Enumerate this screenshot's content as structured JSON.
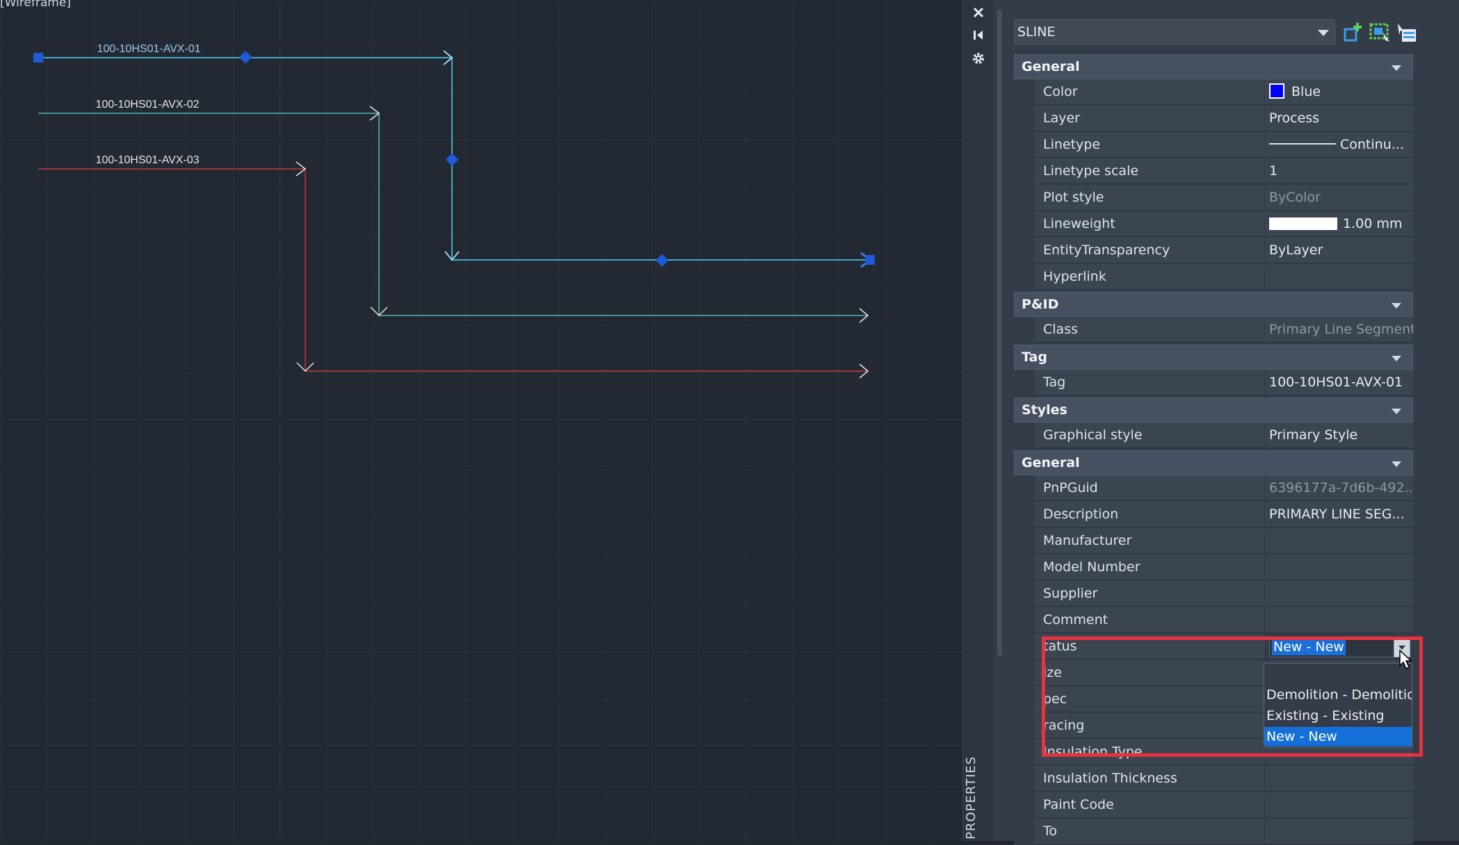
{
  "canvas": {
    "view_label": "[Wireframe]",
    "lines": [
      {
        "tag": "100-10HS01-AVX-01",
        "color": "#4fc6c0",
        "selected": true
      },
      {
        "tag": "100-10HS01-AVX-02",
        "color": "#55b7bd",
        "selected": false
      },
      {
        "tag": "100-10HS01-AVX-03",
        "color": "#c8373b",
        "selected": false
      }
    ]
  },
  "strip": {
    "title": "PROPERTIES",
    "icons": [
      "close-icon",
      "auto-hide-icon",
      "settings-icon"
    ]
  },
  "selector": {
    "value": "SLINE",
    "buttons": [
      "toggle-pickadd-icon",
      "select-objects-icon",
      "quick-select-icon"
    ]
  },
  "sections": [
    {
      "title": "General",
      "rows": [
        {
          "name": "Color",
          "value": "Blue",
          "kind": "color",
          "swatch": "#0000ff"
        },
        {
          "name": "Layer",
          "value": "Process"
        },
        {
          "name": "Linetype",
          "value": "Continu...",
          "kind": "linetype"
        },
        {
          "name": "Linetype scale",
          "value": "1"
        },
        {
          "name": "Plot style",
          "value": "ByColor",
          "dim": true
        },
        {
          "name": "Lineweight",
          "value": "1.00 mm",
          "kind": "lineweight"
        },
        {
          "name": "EntityTransparency",
          "value": "ByLayer"
        },
        {
          "name": "Hyperlink",
          "value": ""
        }
      ]
    },
    {
      "title": "P&ID",
      "rows": [
        {
          "name": "Class",
          "value": "Primary Line Segment",
          "dim": true
        }
      ]
    },
    {
      "title": "Tag",
      "rows": [
        {
          "name": "Tag",
          "value": "100-10HS01-AVX-01"
        }
      ]
    },
    {
      "title": "Styles",
      "rows": [
        {
          "name": "Graphical style",
          "value": "Primary Style"
        }
      ]
    },
    {
      "title": "General",
      "rows": [
        {
          "name": "PnPGuid",
          "value": "6396177a-7d6b-492...",
          "dim": true
        },
        {
          "name": "Description",
          "value": "PRIMARY LINE SEG..."
        },
        {
          "name": "Manufacturer",
          "value": ""
        },
        {
          "name": "Model Number",
          "value": ""
        },
        {
          "name": "Supplier",
          "value": ""
        },
        {
          "name": "Comment",
          "value": ""
        },
        {
          "name": "tatus",
          "value": "",
          "kind": "status"
        },
        {
          "name": "ize",
          "value": ""
        },
        {
          "name": "pec",
          "value": ""
        },
        {
          "name": "racing",
          "value": ""
        },
        {
          "name": "Insulation Type",
          "value": ""
        },
        {
          "name": "Insulation Thickness",
          "value": ""
        },
        {
          "name": "Paint Code",
          "value": ""
        },
        {
          "name": "To",
          "value": ""
        }
      ]
    }
  ],
  "status_field": {
    "current": "New - New",
    "options": [
      "Demolition - Demolition",
      "Existing - Existing",
      "New - New"
    ],
    "selected_index": 2
  },
  "colors": {
    "highlight_box": "#e8323c",
    "selection_blue": "#1470d8",
    "grip_blue": "#1f5bd8"
  }
}
